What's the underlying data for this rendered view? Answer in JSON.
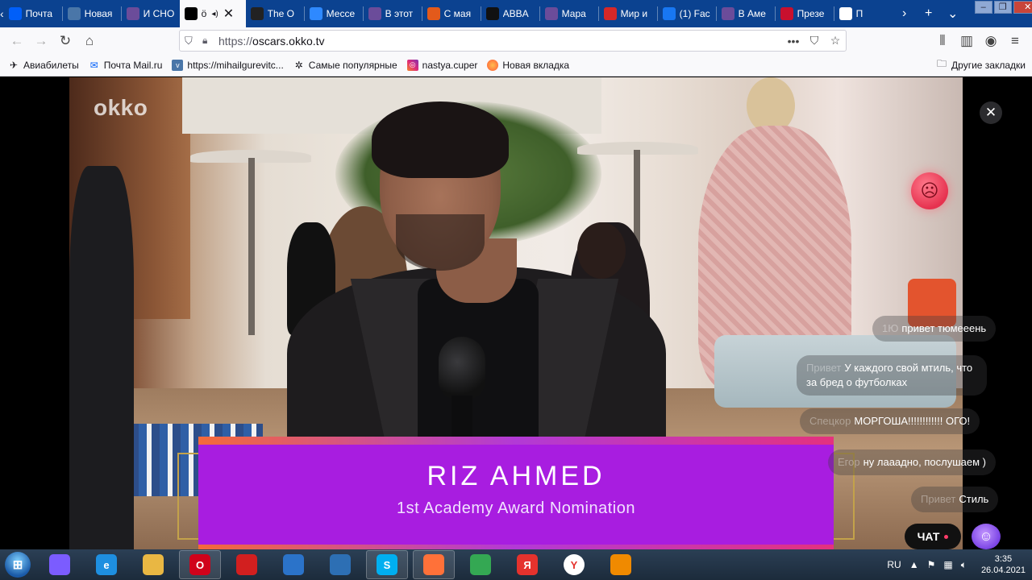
{
  "browser": {
    "tabs": [
      {
        "label": "Почта",
        "icon": "mail-icon",
        "color": "#005ff9",
        "active": false
      },
      {
        "label": "Новая",
        "icon": "vk-icon",
        "color": "#4a76a8",
        "active": false
      },
      {
        "label": "И СНО",
        "icon": "avatar-icon",
        "color": "#6b4c9a",
        "active": false
      },
      {
        "label": "ö",
        "icon": "audio-icon",
        "color": "#000000",
        "active": true
      },
      {
        "label": "The O",
        "icon": "abc-icon",
        "color": "#222222",
        "active": false
      },
      {
        "label": "Мессе",
        "icon": "messenger-icon",
        "color": "#2e89ff",
        "active": false
      },
      {
        "label": "В этот",
        "icon": "avatar-icon",
        "color": "#6b4c9a",
        "active": false
      },
      {
        "label": "С мая",
        "icon": "tnt-icon",
        "color": "#e35a1b",
        "active": false
      },
      {
        "label": "ABBA",
        "icon": "star-icon",
        "color": "#111111",
        "active": false
      },
      {
        "label": "Мара",
        "icon": "avatar-icon",
        "color": "#6b4c9a",
        "active": false
      },
      {
        "label": "Мир и",
        "icon": "red-icon",
        "color": "#d62828",
        "active": false
      },
      {
        "label": "(1) Fac",
        "icon": "facebook-icon",
        "color": "#1877f2",
        "active": false
      },
      {
        "label": "В Аме",
        "icon": "avatar-icon",
        "color": "#6b4c9a",
        "active": false
      },
      {
        "label": "Презе",
        "icon": "m-icon",
        "color": "#c8102e",
        "active": false
      },
      {
        "label": "П",
        "icon": "wikipedia-icon",
        "color": "#ffffff",
        "active": false
      }
    ],
    "url_prefix": "https://",
    "url_domain": "oscars.okko.tv"
  },
  "bookmarks": [
    {
      "label": "Авиабилеты",
      "icon": "plane-icon"
    },
    {
      "label": "Почта Mail.ru",
      "icon": "mail-icon"
    },
    {
      "label": "https://mihailgurevitc...",
      "icon": "vk-icon"
    },
    {
      "label": "Самые популярные",
      "icon": "gear-icon"
    },
    {
      "label": "nastya.cuper",
      "icon": "instagram-icon"
    },
    {
      "label": "Новая вкладка",
      "icon": "firefox-icon"
    }
  ],
  "bookmarks_other": "Другие закладки",
  "player": {
    "logo": "okko",
    "name": "RIZ AHMED",
    "subtitle": "1st Academy Award Nomination",
    "chat_button": "ЧАТ"
  },
  "chat": [
    {
      "author": "1Ю",
      "text": "привет тюмееень"
    },
    {
      "author": "Привет",
      "text": "У каждого свой мтиль, что за бред о футболках"
    },
    {
      "author": "Спецкор",
      "text": "МОРГОША!!!!!!!!!!!! ОГО!"
    },
    {
      "author": "Егор",
      "text": "ну лааадно, послушаем )"
    },
    {
      "author": "Привет",
      "text": "Стиль"
    }
  ],
  "taskbar": {
    "apps": [
      {
        "name": "alisa-icon",
        "color": "#7b5cff",
        "label": ""
      },
      {
        "name": "ie-icon",
        "color": "#1e8fe0",
        "label": "e"
      },
      {
        "name": "folder-icon",
        "color": "#e9b743",
        "label": ""
      },
      {
        "name": "opera-icon",
        "color": "#d0021b",
        "label": "O"
      },
      {
        "name": "game-icon",
        "color": "#d21f1f",
        "label": ""
      },
      {
        "name": "wbc-icon",
        "color": "#2b73c9",
        "label": ""
      },
      {
        "name": "kmplayer-icon",
        "color": "#2d6fb4",
        "label": ""
      },
      {
        "name": "skype-icon",
        "color": "#00aff0",
        "label": "S"
      },
      {
        "name": "firefox-icon",
        "color": "#ff7139",
        "label": ""
      },
      {
        "name": "chrome-icon",
        "color": "#34a853",
        "label": ""
      },
      {
        "name": "yandex-browser-icon",
        "color": "#e5322d",
        "label": "Я"
      },
      {
        "name": "yandex-icon",
        "color": "#ffffff",
        "label": "Y"
      },
      {
        "name": "vlc-icon",
        "color": "#f08a00",
        "label": ""
      }
    ],
    "lang": "RU",
    "time": "3:35",
    "date": "26.04.2021"
  }
}
